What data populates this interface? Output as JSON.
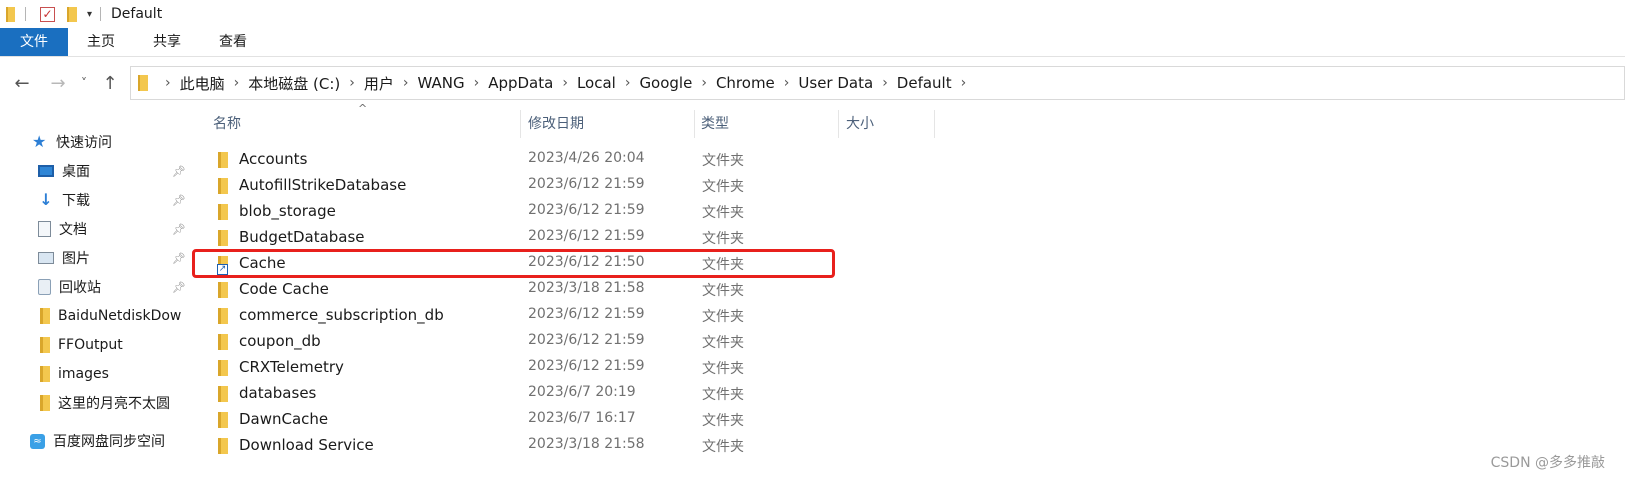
{
  "window": {
    "title": "Default",
    "qa_dropdown": "▾"
  },
  "ribbon": {
    "tabs": [
      "文件",
      "主页",
      "共享",
      "查看"
    ]
  },
  "nav": {
    "back": "←",
    "forward": "→",
    "recent": "˅",
    "up": "↑",
    "breadcrumbs": [
      "此电脑",
      "本地磁盘 (C:)",
      "用户",
      "WANG",
      "AppData",
      "Local",
      "Google",
      "Chrome",
      "User Data",
      "Default"
    ]
  },
  "sidebar": {
    "quick_access": "快速访问",
    "items": [
      {
        "label": "桌面",
        "icon": "desktop-icon",
        "pinned": true
      },
      {
        "label": "下载",
        "icon": "download-icon",
        "pinned": true
      },
      {
        "label": "文档",
        "icon": "documents-icon",
        "pinned": true
      },
      {
        "label": "图片",
        "icon": "pictures-icon",
        "pinned": true
      },
      {
        "label": "回收站",
        "icon": "recycle-bin-icon",
        "pinned": true
      },
      {
        "label": "BaiduNetdiskDow",
        "icon": "folder-icon",
        "pinned": false
      },
      {
        "label": "FFOutput",
        "icon": "folder-icon",
        "pinned": false
      },
      {
        "label": "images",
        "icon": "folder-icon",
        "pinned": false
      },
      {
        "label": "这里的月亮不太圆",
        "icon": "folder-icon",
        "pinned": false
      }
    ],
    "cloud": "百度网盘同步空间"
  },
  "columns": {
    "name": "名称",
    "date": "修改日期",
    "type": "类型",
    "size": "大小",
    "sort_indicator": "^"
  },
  "files": [
    {
      "name": "Accounts",
      "date": "2023/4/26 20:04",
      "type": "文件夹"
    },
    {
      "name": "AutofillStrikeDatabase",
      "date": "2023/6/12 21:59",
      "type": "文件夹"
    },
    {
      "name": "blob_storage",
      "date": "2023/6/12 21:59",
      "type": "文件夹"
    },
    {
      "name": "BudgetDatabase",
      "date": "2023/6/12 21:59",
      "type": "文件夹"
    },
    {
      "name": "Cache",
      "date": "2023/6/12 21:50",
      "type": "文件夹",
      "shortcut": true
    },
    {
      "name": "Code Cache",
      "date": "2023/3/18 21:58",
      "type": "文件夹"
    },
    {
      "name": "commerce_subscription_db",
      "date": "2023/6/12 21:59",
      "type": "文件夹"
    },
    {
      "name": "coupon_db",
      "date": "2023/6/12 21:59",
      "type": "文件夹"
    },
    {
      "name": "CRXTelemetry",
      "date": "2023/6/12 21:59",
      "type": "文件夹"
    },
    {
      "name": "databases",
      "date": "2023/6/7 20:19",
      "type": "文件夹"
    },
    {
      "name": "DawnCache",
      "date": "2023/6/7 16:17",
      "type": "文件夹"
    },
    {
      "name": "Download Service",
      "date": "2023/3/18 21:58",
      "type": "文件夹"
    }
  ],
  "watermark": "CSDN @多多推敲",
  "colors": {
    "file_tab": "#1a6fc0",
    "highlight": "#e8201c",
    "folder": "#f3c74e"
  }
}
